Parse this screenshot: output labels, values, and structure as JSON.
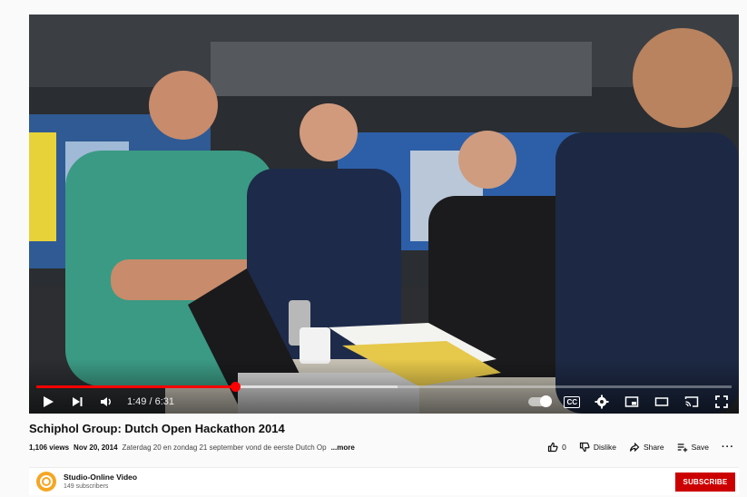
{
  "video": {
    "progress_fraction": 0.286,
    "buffered_fraction": 0.52,
    "time_display": "1:49 / 6:31",
    "controls": {
      "play": "play-icon",
      "next": "next-icon",
      "volume": "volume-icon",
      "autoplay": "autoplay-toggle",
      "captions": "CC",
      "settings": "gear-icon",
      "miniplayer": "miniplayer-icon",
      "theater": "theater-icon",
      "cast": "cast-icon",
      "fullscreen": "fullscreen-icon"
    }
  },
  "title": "Schiphol Group: Dutch Open Hackathon 2014",
  "meta": {
    "views": "1,106 views",
    "date": "Nov 20, 2014",
    "description": "Zaterdag 20 en zondag 21 september vond de eerste Dutch Op",
    "more": "...more"
  },
  "actions": {
    "like_count": "0",
    "dislike": "Dislike",
    "share": "Share",
    "save": "Save"
  },
  "channel": {
    "name": "Studio-Online Video",
    "subscribers": "149 subscribers",
    "subscribe": "SUBSCRIBE"
  },
  "colors": {
    "progress": "#ff0000",
    "subscribe_bg": "#cc0000",
    "avatar": "#f5a623"
  }
}
